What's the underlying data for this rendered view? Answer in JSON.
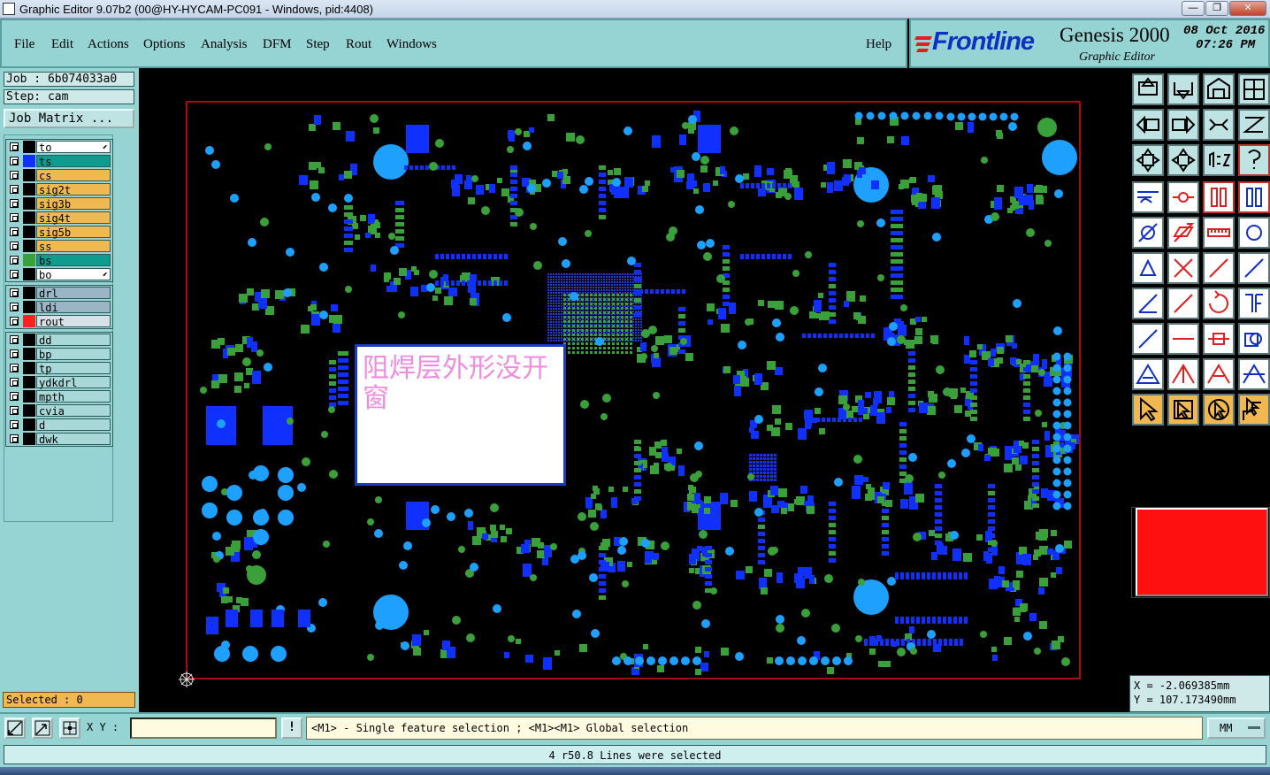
{
  "window": {
    "title": "Graphic Editor 9.07b2 (00@HY-HYCAM-PC091 - Windows, pid:4408)",
    "min_glyph": "—",
    "max_glyph": "❐",
    "close_glyph": "✕"
  },
  "menu": {
    "items": [
      "File",
      "Edit",
      "Actions",
      "Options",
      "Analysis",
      "DFM",
      "Step",
      "Rout",
      "Windows"
    ],
    "help": "Help"
  },
  "brand": {
    "logo": "Frontline",
    "product": "Genesis 2000",
    "subtitle": "Graphic Editor",
    "date": "08 Oct 2016",
    "time": "07:26 PM"
  },
  "job": {
    "job_label": "Job : 6b074033a0",
    "step_label": "Step: cam",
    "matrix_button": "Job Matrix ..."
  },
  "layers": {
    "group1": [
      {
        "name": "to",
        "color": "#ffffff",
        "swatch": "#000000",
        "arrow": true
      },
      {
        "name": "ts",
        "color": "#0f9b8e",
        "swatch": "#1030ff",
        "arrow": false
      },
      {
        "name": "cs",
        "color": "#f0b850",
        "swatch": "#000000",
        "arrow": false
      },
      {
        "name": "sig2t",
        "color": "#f0b850",
        "swatch": "#000000",
        "arrow": false
      },
      {
        "name": "sig3b",
        "color": "#f0b850",
        "swatch": "#000000",
        "arrow": false
      },
      {
        "name": "sig4t",
        "color": "#f0b850",
        "swatch": "#000000",
        "arrow": false
      },
      {
        "name": "sig5b",
        "color": "#f0b850",
        "swatch": "#000000",
        "arrow": false
      },
      {
        "name": "ss",
        "color": "#f0b850",
        "swatch": "#000000",
        "arrow": false
      },
      {
        "name": "bs",
        "color": "#0f9b8e",
        "swatch": "#3aa03a",
        "arrow": false
      },
      {
        "name": "bo",
        "color": "#ffffff",
        "swatch": "#000000",
        "arrow": true
      }
    ],
    "group2": [
      {
        "name": "drl",
        "color": "#9ab5c5",
        "swatch": "#000000"
      },
      {
        "name": "ldi",
        "color": "#9ab5c5",
        "swatch": "#000000"
      },
      {
        "name": "rout",
        "color": "#d8e0e8",
        "swatch": "#ff2020"
      }
    ],
    "group3": [
      {
        "name": "dd",
        "color": "#a8d8d8",
        "swatch": "#000000"
      },
      {
        "name": "bp",
        "color": "#a8d8d8",
        "swatch": "#000000"
      },
      {
        "name": "tp",
        "color": "#a8d8d8",
        "swatch": "#000000"
      },
      {
        "name": "ydkdrl",
        "color": "#a8d8d8",
        "swatch": "#000000"
      },
      {
        "name": "mpth",
        "color": "#a8d8d8",
        "swatch": "#000000"
      },
      {
        "name": "cvia",
        "color": "#a8d8d8",
        "swatch": "#000000"
      },
      {
        "name": "d",
        "color": "#a8d8d8",
        "swatch": "#000000"
      },
      {
        "name": "dwk",
        "color": "#a8d8d8",
        "swatch": "#000000"
      }
    ]
  },
  "selection": {
    "label": "Selected : 0"
  },
  "annotation": {
    "text": "阻焊层外形没开窗"
  },
  "coords": {
    "x": "X = -2.069385mm",
    "y": "Y = 107.173490mm"
  },
  "status": {
    "xy_label": "X Y :",
    "xy_value": "",
    "warning_glyph": "!",
    "message": "<M1> - Single feature selection ; <M1><M1> Global selection",
    "units": "MM",
    "info": "4 r50.8 Lines were selected"
  },
  "colors": {
    "panel": "#96d3d3",
    "ts_pad": "#1030ff",
    "bs_pad": "#3aa03a",
    "hole": "#1ea0ff",
    "outline": "#e01010",
    "preview": "#ff1010"
  }
}
